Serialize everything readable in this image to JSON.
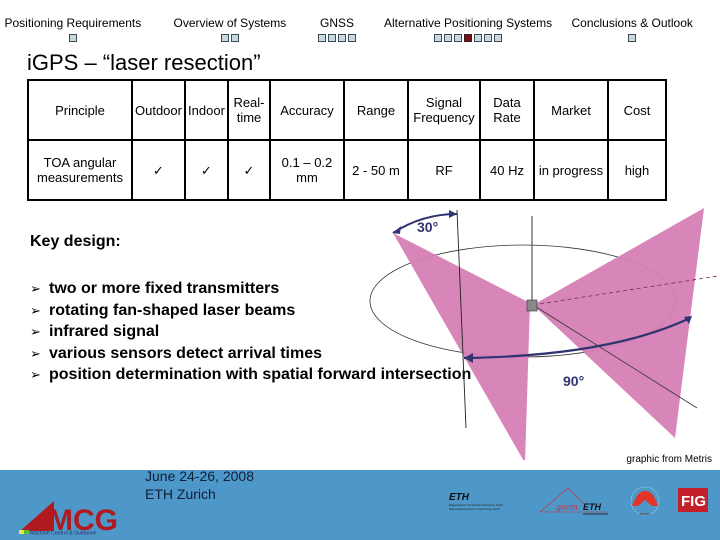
{
  "nav": {
    "sections": [
      {
        "label": "Positioning Requirements",
        "dots": 1,
        "active": -1
      },
      {
        "label": "Overview of Systems",
        "dots": 2,
        "active": -1
      },
      {
        "label": "GNSS",
        "dots": 4,
        "active": -1
      },
      {
        "label": "Alternative Positioning Systems",
        "dots": 7,
        "active": 3
      },
      {
        "label": "Conclusions & Outlook",
        "dots": 1,
        "active": -1
      }
    ]
  },
  "slide": {
    "title": "iGPS – “laser resection”",
    "table": {
      "headers": [
        "Principle",
        "Outdoor",
        "Indoor",
        "Real-time",
        "Accuracy",
        "Range",
        "Signal Frequency",
        "Data Rate",
        "Market",
        "Cost"
      ],
      "row": [
        "TOA angular measurements",
        "✓",
        "✓",
        "✓",
        "0.1 – 0.2 mm",
        "2 - 50 m",
        "RF",
        "40 Hz",
        "in progress",
        "high"
      ]
    },
    "key_heading": "Key design:",
    "bullets": [
      "two or more fixed transmitters",
      "rotating fan-shaped laser beams",
      "infrared signal",
      "various sensors detect arrival times",
      "position determination with spatial forward intersection"
    ],
    "diagram": {
      "angle_tilt_label": "30°",
      "angle_rotation_label": "90°",
      "fan_color": "#d67fb5",
      "arrow_color": "#2f3470"
    },
    "credit": "graphic from Metris"
  },
  "footer": {
    "bg_color": "#4d98c9",
    "logo_mcg": {
      "wordmark": "MCG",
      "tagline": "Machine Control & Guidance"
    },
    "event_date": "June 24-26, 2008",
    "event_place": "ETH Zurich",
    "logo_eth": {
      "wordmark": "ETH",
      "line1": "Eidgenössische Technische Hochschule Zürich",
      "line2": "Swiss Federal Institute of Technology Zurich"
    },
    "logo_geomETH": {
      "part1": "geom",
      "part2": "ETH"
    },
    "logo_fig": "FIG"
  }
}
